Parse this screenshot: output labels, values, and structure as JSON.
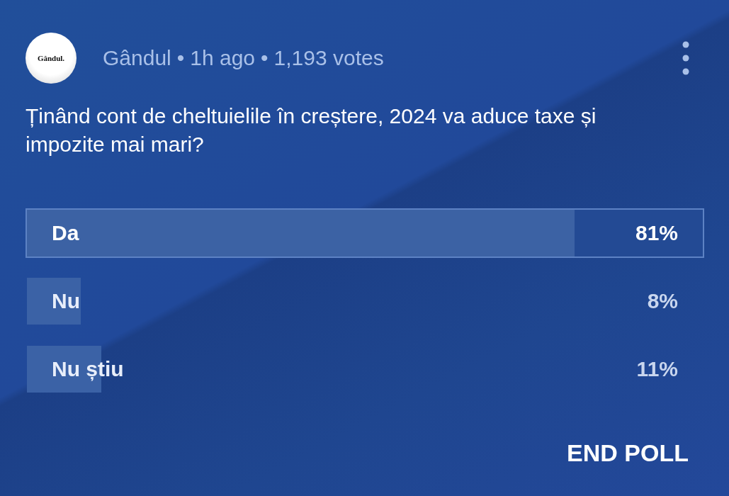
{
  "post": {
    "avatar_text": "Gândul.",
    "author": "Gândul",
    "separator_1": "•",
    "time": "1h ago",
    "separator_2": "•",
    "votes": "1,193 votes"
  },
  "question": "Ținând cont de cheltuielile în creștere, 2024 va aduce taxe și impozite mai mari?",
  "options": [
    {
      "label": "Da",
      "percent": "81%",
      "level": 0.81,
      "selected": true
    },
    {
      "label": "Nu",
      "percent": "8%",
      "level": 0.08,
      "selected": false
    },
    {
      "label": "Nu știu",
      "percent": "11%",
      "level": 0.11,
      "selected": false
    }
  ],
  "action": "END POLL"
}
